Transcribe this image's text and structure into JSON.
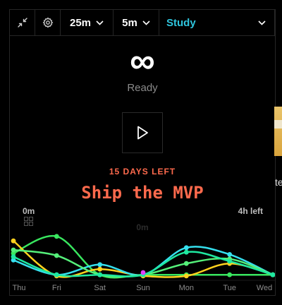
{
  "toolbar": {
    "focus_duration": "25m",
    "break_duration": "5m",
    "mode": "Study"
  },
  "timer": {
    "display": "∞",
    "status": "Ready"
  },
  "goal": {
    "days_left": "15 DAYS LEFT",
    "title": "Ship the MVP"
  },
  "stats": {
    "today": "0m",
    "remaining": "4h left",
    "center": "0m"
  },
  "side_panel": {
    "text": "te"
  },
  "colors": {
    "accent_cyan": "#2fc5dd",
    "goal_orange": "#ff6a4d"
  },
  "chart_data": {
    "type": "line",
    "categories": [
      "Thu",
      "Fri",
      "Sat",
      "Sun",
      "Mon",
      "Tue",
      "Wed"
    ],
    "ylim": [
      0,
      5
    ],
    "grid": false,
    "series": [
      {
        "color": "#39e75f",
        "values": [
          2.2,
          3.7,
          0.3,
          0.3,
          0.3,
          0.3,
          0.3
        ]
      },
      {
        "color": "#ffd21e",
        "values": [
          3.3,
          0.2,
          0.8,
          0.2,
          0.2,
          1.3,
          0.3
        ]
      },
      {
        "color": "#35e0ee",
        "values": [
          1.6,
          0.3,
          1.2,
          0.3,
          2.7,
          2.1,
          0.3
        ]
      },
      {
        "color": "#55f07a",
        "values": [
          2.5,
          2.0,
          0.3,
          0.3,
          1.3,
          1.7,
          0.3
        ]
      },
      {
        "color": "#1ee8a0",
        "values": [
          1.9,
          0.3,
          0.3,
          0.3,
          2.3,
          1.5,
          0.3
        ]
      },
      {
        "color": "#e040fb",
        "values": [
          0,
          0,
          0,
          0.5,
          0,
          0,
          0
        ]
      }
    ]
  }
}
